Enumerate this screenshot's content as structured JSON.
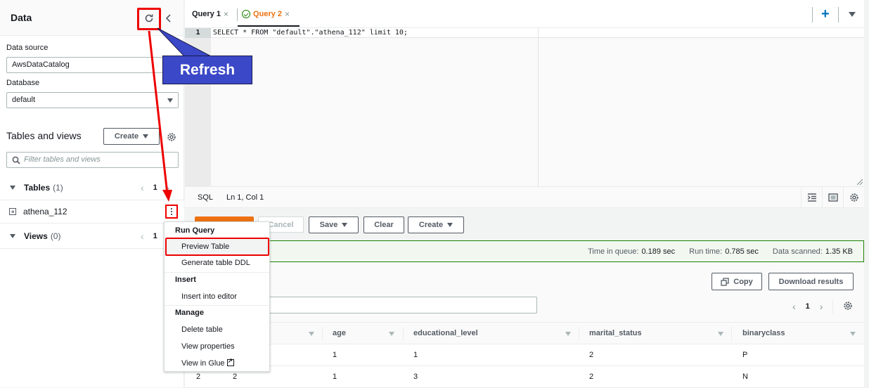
{
  "left_panel": {
    "title": "Data",
    "data_source_label": "Data source",
    "data_source_value": "AwsDataCatalog",
    "database_label": "Database",
    "database_value": "default",
    "tables_and_views_title": "Tables and views",
    "create_label": "Create",
    "filter_placeholder": "Filter tables and views",
    "tables_label": "Tables",
    "tables_count": "(1)",
    "tables_page": "1",
    "table_items": [
      "athena_112"
    ],
    "views_label": "Views",
    "views_count": "(0)",
    "views_page": "1"
  },
  "tabs": [
    {
      "label": "Query 1",
      "active": false
    },
    {
      "label": "Query 2",
      "active": true
    }
  ],
  "editor": {
    "line_number": "1",
    "code": "SELECT * FROM \"default\".\"athena_112\" limit 10;",
    "language": "SQL",
    "cursor_position": "Ln 1, Col 1"
  },
  "actions": {
    "cancel_label": "Cancel",
    "save_label": "Save",
    "clear_label": "Clear",
    "create_label": "Create"
  },
  "stats": {
    "queue_label": "Time in queue:",
    "queue_value": "0.189 sec",
    "run_label": "Run time:",
    "run_value": "0.785 sec",
    "scanned_label": "Data scanned:",
    "scanned_value": "1.35 KB"
  },
  "results": {
    "copy_label": "Copy",
    "download_label": "Download results",
    "page": "1",
    "columns": [
      "",
      "age",
      "educational_level",
      "marital_status",
      "binaryclass"
    ],
    "rows": [
      [
        "",
        "",
        "1",
        "1",
        "2",
        "P"
      ],
      [
        "2",
        "2",
        "1",
        "3",
        "2",
        "N"
      ]
    ]
  },
  "context_menu": {
    "groups": [
      {
        "title": "Run Query",
        "items": [
          "Preview Table",
          "Generate table DDL"
        ]
      },
      {
        "title": "Insert",
        "items": [
          "Insert into editor"
        ]
      },
      {
        "title": "Manage",
        "items": [
          "Delete table",
          "View properties",
          "View in Glue"
        ]
      }
    ]
  },
  "annotation": {
    "callout_text": "Refresh"
  }
}
